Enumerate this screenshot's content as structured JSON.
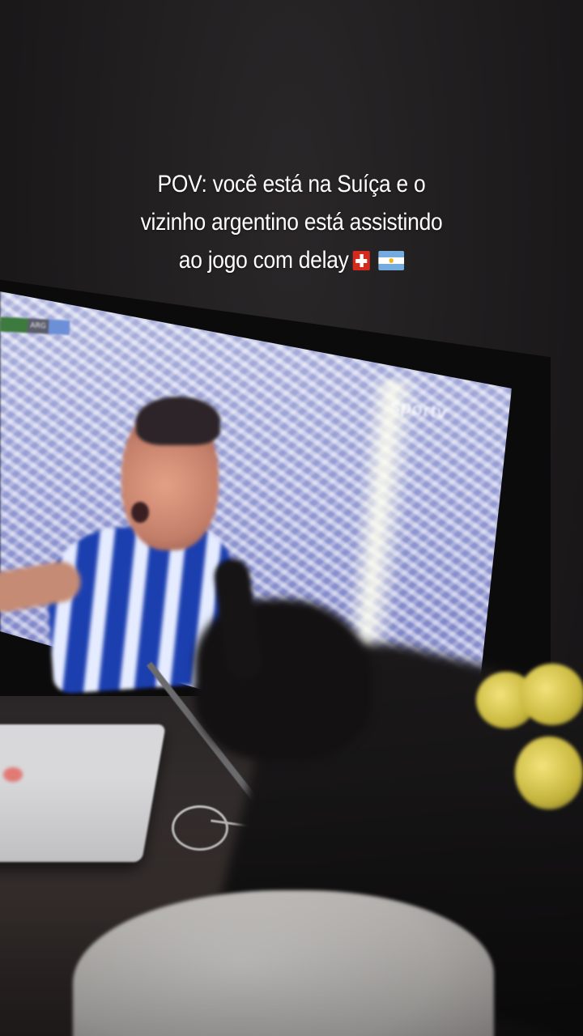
{
  "caption": {
    "line1": "POV: você está na Suíça e o",
    "line2": "vizinho argentino está assistindo",
    "line3": "ao jogo com delay",
    "emoji_flags": [
      "flag-switzerland-icon",
      "flag-argentina-icon"
    ]
  },
  "tv": {
    "scorebug_team": "ARG",
    "broadcaster_logo": "sportv"
  },
  "colors": {
    "caption_text": "#ffffff",
    "switzerland_red": "#d52b1e",
    "argentina_blue": "#74acdf"
  }
}
